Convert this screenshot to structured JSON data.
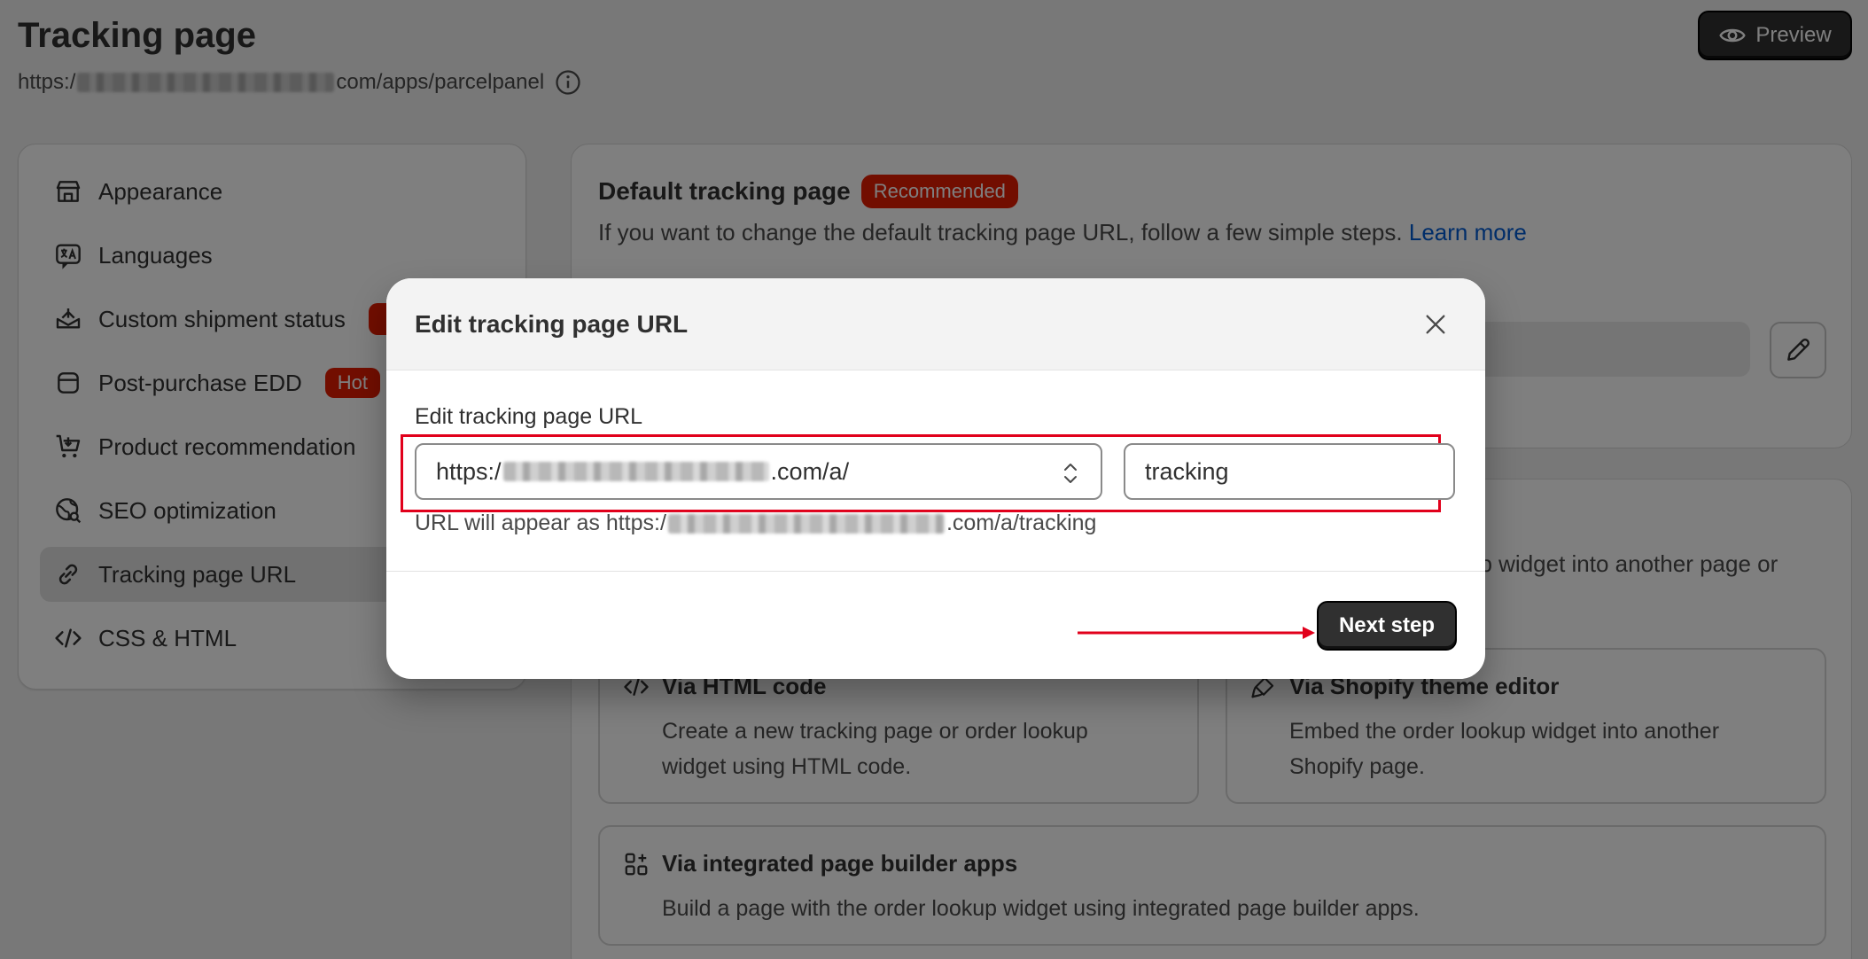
{
  "header": {
    "title": "Tracking page",
    "url_prefix": "https:/",
    "url_suffix": "com/apps/parcelpanel",
    "preview_label": "Preview"
  },
  "sidebar": {
    "items": [
      {
        "label": "Appearance",
        "icon": "store-icon"
      },
      {
        "label": "Languages",
        "icon": "language-icon"
      },
      {
        "label": "Custom shipment status",
        "icon": "box-icon"
      },
      {
        "label": "Post-purchase EDD",
        "icon": "calendar-icon",
        "badge": "Hot"
      },
      {
        "label": "Product recommendation",
        "icon": "cart-icon"
      },
      {
        "label": "SEO optimization",
        "icon": "globe-icon"
      },
      {
        "label": "Tracking page URL",
        "icon": "link-icon"
      },
      {
        "label": "CSS & HTML",
        "icon": "code-icon"
      }
    ],
    "active": "Tracking page URL"
  },
  "card1": {
    "title": "Default tracking page",
    "badge": "Recommended",
    "desc": "If you want to change the default tracking page URL, follow a few simple steps.",
    "link": "Learn more"
  },
  "card2": {
    "desc_line1": "up widget into another page or",
    "options": [
      {
        "title": "Via HTML code",
        "desc": "Create a new tracking page or order lookup widget using HTML code."
      },
      {
        "title": "Via Shopify theme editor",
        "desc": "Embed the order lookup widget into another Shopify page."
      },
      {
        "title": "Via integrated page builder apps",
        "desc": "Build a page with the order lookup widget using integrated page builder apps."
      }
    ]
  },
  "modal": {
    "title": "Edit tracking page URL",
    "field_label": "Edit tracking page URL",
    "select_prefix": "https:/",
    "select_suffix": ".com/a/",
    "path_value": "tracking",
    "hint_prefix": "URL will appear as https:/",
    "hint_suffix": ".com/a/tracking",
    "next_label": "Next step"
  },
  "colors": {
    "accent_dark": "#303030",
    "badge_red": "#e51c00",
    "highlight_red": "#e1001b",
    "link_blue": "#005bd3"
  }
}
